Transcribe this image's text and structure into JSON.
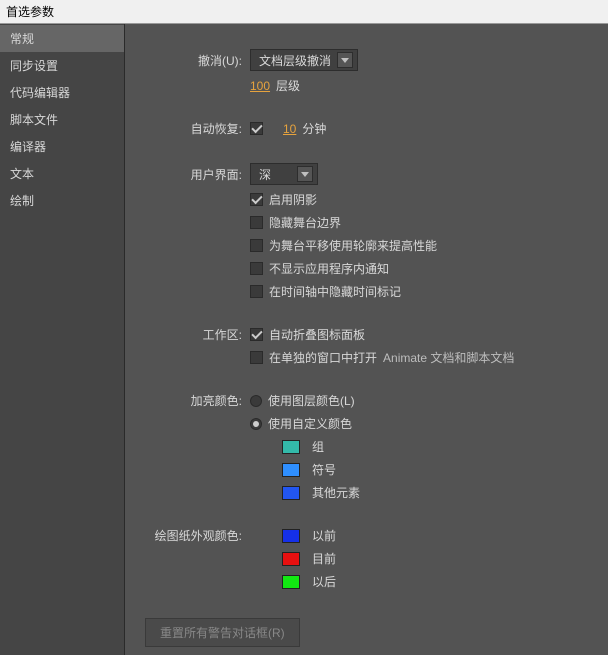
{
  "window": {
    "title": "首选参数"
  },
  "sidebar": {
    "items": [
      {
        "label": "常规",
        "selected": true
      },
      {
        "label": "同步设置"
      },
      {
        "label": "代码编辑器"
      },
      {
        "label": "脚本文件"
      },
      {
        "label": "编译器"
      },
      {
        "label": "文本"
      },
      {
        "label": "绘制"
      }
    ]
  },
  "general": {
    "undo": {
      "label": "撤消(U):",
      "dropdown_value": "文档层级撤消",
      "levels_value": "100",
      "levels_unit": "层级"
    },
    "autorecover": {
      "label": "自动恢复:",
      "checked": true,
      "minutes_value": "10",
      "minutes_unit": "分钟"
    },
    "ui": {
      "label": "用户界面:",
      "dropdown_value": "深",
      "checkboxes": [
        {
          "label": "启用阴影",
          "checked": true
        },
        {
          "label": "隐藏舞台边界",
          "checked": false
        },
        {
          "label": "为舞台平移使用轮廓来提高性能",
          "checked": false
        },
        {
          "label": "不显示应用程序内通知",
          "checked": false
        },
        {
          "label": "在时间轴中隐藏时间标记",
          "checked": false
        }
      ]
    },
    "workspace": {
      "label": "工作区:",
      "items": [
        {
          "label": "自动折叠图标面板",
          "checked": true
        },
        {
          "label": "在单独的窗口中打开",
          "checked": false,
          "suffix": "Animate 文档和脚本文档"
        }
      ]
    },
    "highlight": {
      "label": "加亮颜色:",
      "radios": [
        {
          "label": "使用图层颜色(L)",
          "checked": false
        },
        {
          "label": "使用自定义颜色",
          "checked": true
        }
      ],
      "swatches": [
        {
          "color": "#33b9a9",
          "label": "组"
        },
        {
          "color": "#2f8fff",
          "label": "符号"
        },
        {
          "color": "#2256f0",
          "label": "其他元素"
        }
      ]
    },
    "outline": {
      "label": "绘图纸外观颜色:",
      "swatches": [
        {
          "color": "#1530e8",
          "label": "以前"
        },
        {
          "color": "#e81010",
          "label": "目前"
        },
        {
          "color": "#12e812",
          "label": "以后"
        }
      ]
    },
    "reset_button": "重置所有警告对话框(R)"
  }
}
